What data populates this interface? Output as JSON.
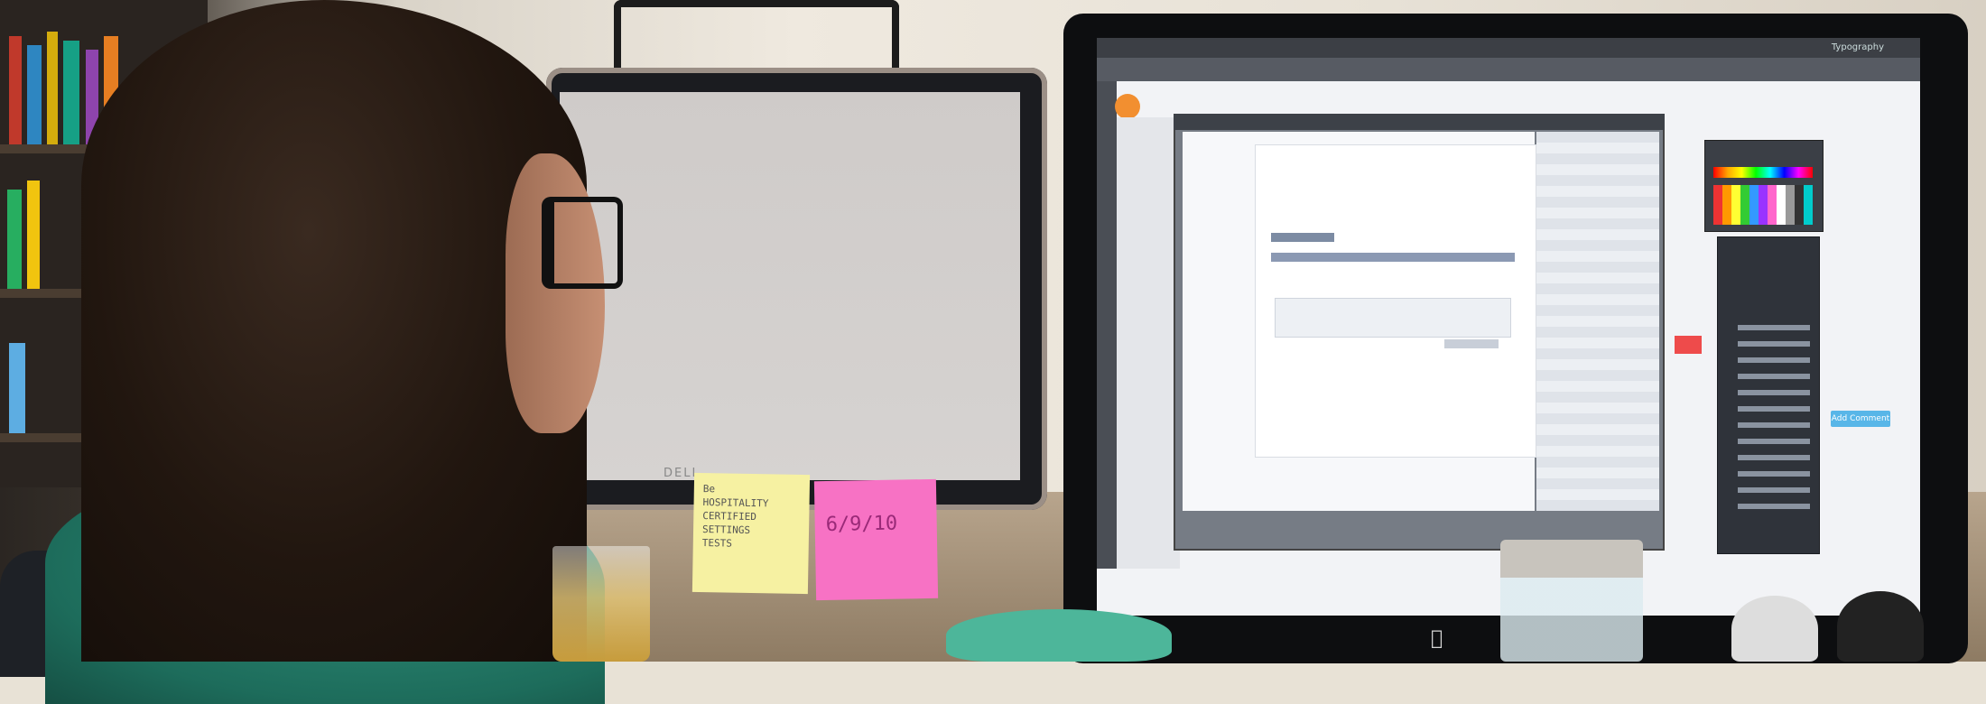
{
  "scene": {
    "description_free": true
  },
  "left_monitor": {
    "logo_text": "DELL"
  },
  "sticky_yellow": {
    "text": "Be\nHOSPITALITY\nCERTIFIED\nSETTINGS\nTESTS"
  },
  "sticky_pink": {
    "text": "6/9/10"
  },
  "app": {
    "menubar_right": "Typography",
    "add_button_label": "Add Comment"
  },
  "colors": {
    "sweater": "#1d6c5b",
    "sticky_yellow": "#f6f1a2",
    "sticky_pink": "#f772c4",
    "app_icon": "#f28f30",
    "add_button": "#58b6e8",
    "bowl": "#4db69a"
  }
}
